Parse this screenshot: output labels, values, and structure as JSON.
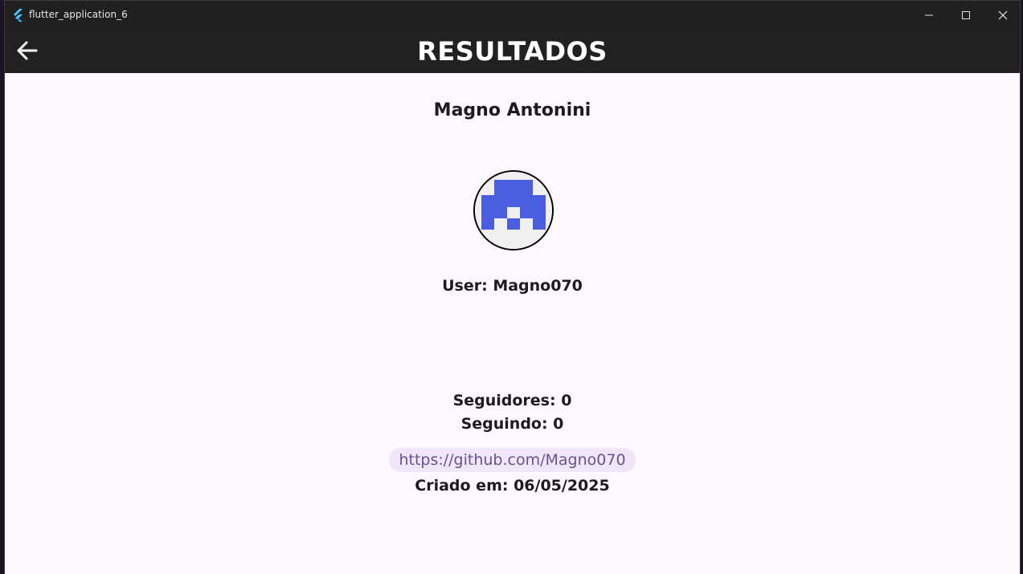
{
  "window": {
    "title": "flutter_application_6",
    "icon": "flutter-logo-icon"
  },
  "appbar": {
    "title": "RESULTADOS",
    "back_icon": "arrow-back-icon"
  },
  "profile": {
    "name": "Magno Antonini",
    "avatar_icon": "identicon-avatar",
    "avatar_color": "#4b5ee0",
    "user": "User: Magno070",
    "followers": "Seguidores: 0",
    "following": "Seguindo: 0",
    "url": "https://github.com/Magno070",
    "created": "Criado em: 06/05/2025"
  },
  "colors": {
    "appbar_bg": "#212121",
    "content_bg": "#fdf7ff",
    "link_text": "#65558f",
    "link_bg": "#efe6f7"
  }
}
